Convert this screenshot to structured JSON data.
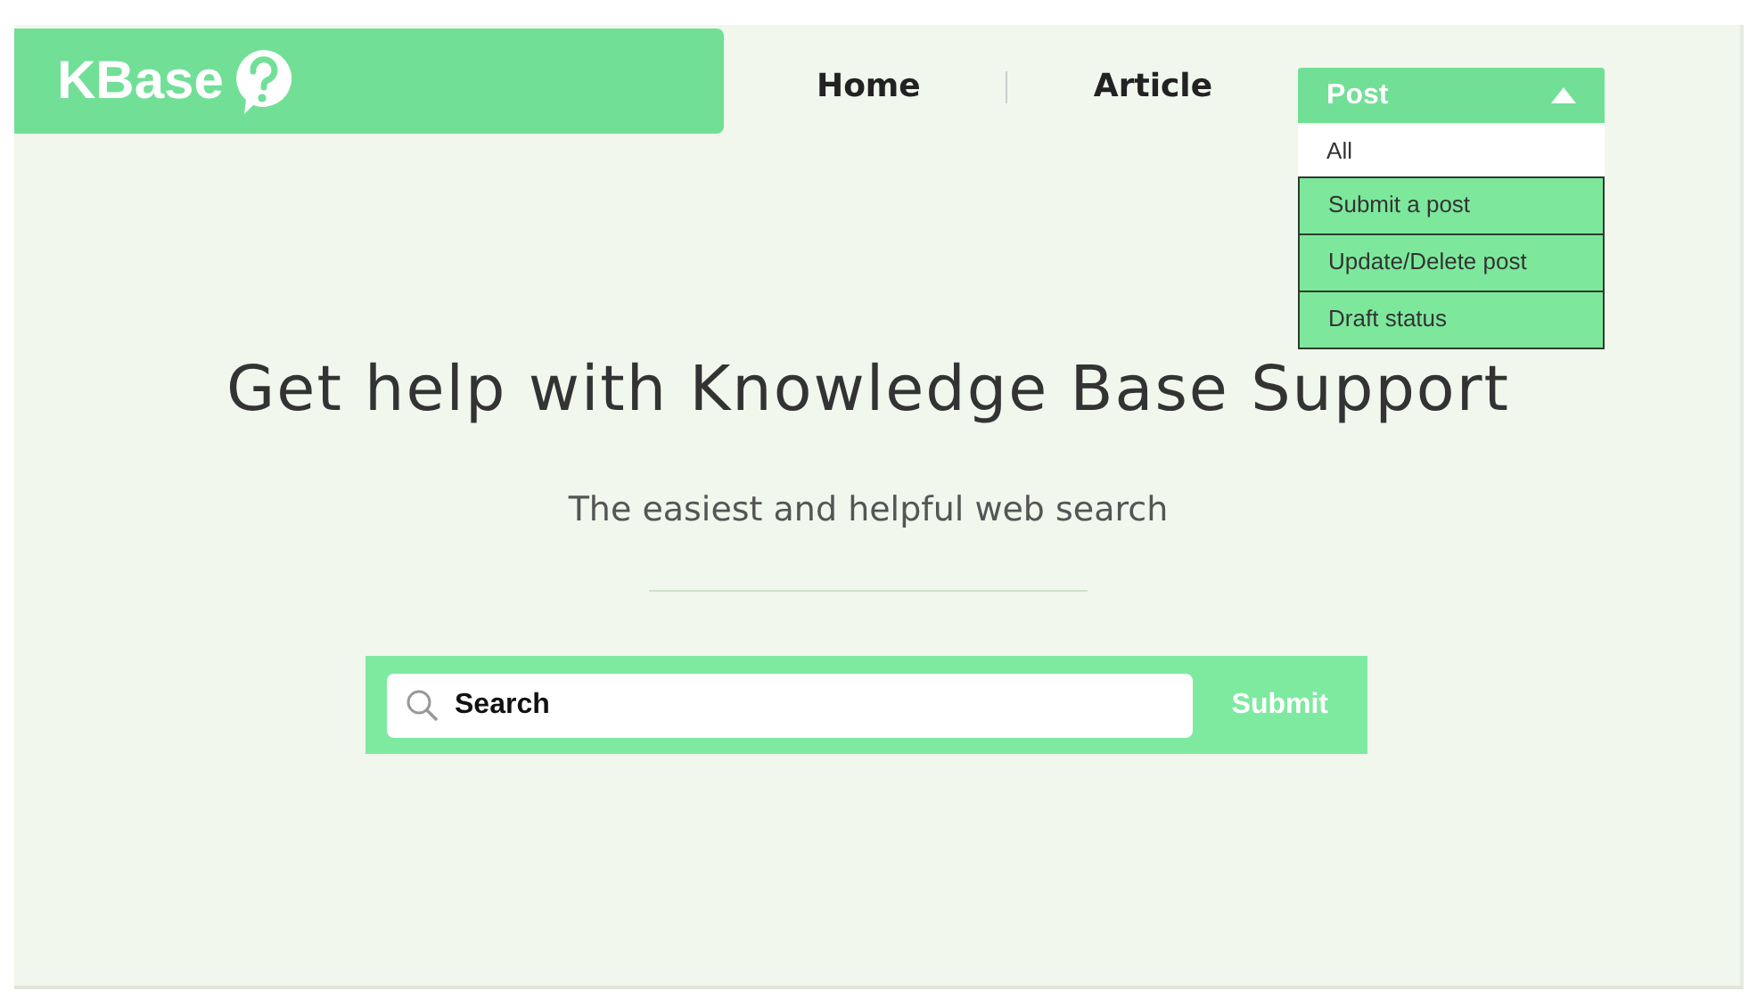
{
  "logo": {
    "text": "KBase"
  },
  "nav": [
    {
      "label": "Home"
    },
    {
      "label": "Article"
    }
  ],
  "post_menu": {
    "label": "Post",
    "expanded": true,
    "items": [
      {
        "label": "All",
        "selected": true
      },
      {
        "label": "Submit a post",
        "selected": false
      },
      {
        "label": "Update/Delete post",
        "selected": false
      },
      {
        "label": "Draft status",
        "selected": false
      }
    ]
  },
  "heading": "Get help with Knowledge Base Support",
  "subtitle": "The easiest and helpful web search",
  "search": {
    "value": "Search",
    "button": "Submit"
  }
}
